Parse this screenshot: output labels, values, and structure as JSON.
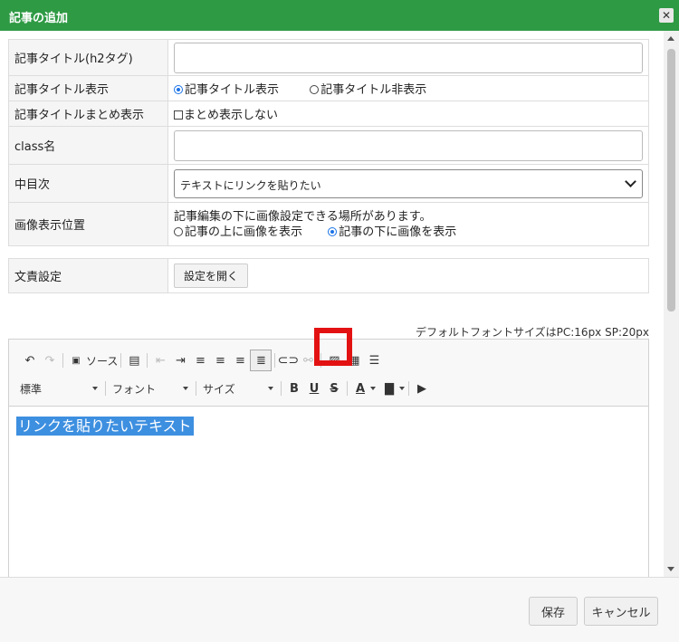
{
  "dialog": {
    "title": "記事の追加",
    "close_icon": "close-icon"
  },
  "form": {
    "title_label": "記事タイトル(h2タグ)",
    "title_value": "",
    "display_label": "記事タイトル表示",
    "display_options": [
      "記事タイトル表示",
      "記事タイトル非表示"
    ],
    "display_selected": "記事タイトル表示",
    "summary_label": "記事タイトルまとめ表示",
    "summary_checkbox": "まとめ表示しない",
    "summary_checked": false,
    "class_label": "class名",
    "class_value": "",
    "toc_label": "中目次",
    "toc_value": "テキストにリンクを貼りたい",
    "image_label": "画像表示位置",
    "image_note": "記事編集の下に画像設定できる場所があります。",
    "image_options": [
      "記事の上に画像を表示",
      "記事の下に画像を表示"
    ],
    "image_selected": "記事の下に画像を表示",
    "doc_label": "文責設定",
    "doc_button": "設定を開く"
  },
  "editor": {
    "font_note": "デフォルトフォントサイズはPC:16px SP:20px",
    "source_label": "ソース",
    "format_combo": "標準",
    "font_combo": "フォント",
    "size_combo": "サイズ",
    "content_text": "リンクを貼りたいテキスト",
    "highlighted_tool": "link-icon"
  },
  "footer": {
    "save_label": "保存",
    "cancel_label": "キャンセル"
  },
  "colors": {
    "titlebar": "#2e9a44",
    "highlight": "#e31212",
    "selection": "#3d8fe0"
  }
}
